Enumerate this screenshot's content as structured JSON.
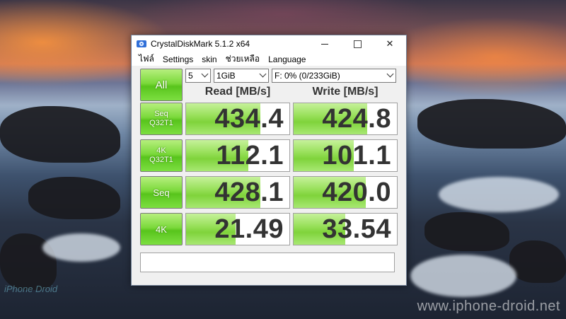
{
  "window": {
    "title": "CrystalDiskMark 5.1.2 x64",
    "close_glyph": "✕"
  },
  "menu": {
    "items": [
      "ไฟล์",
      "Settings",
      "skin",
      "ช่วยเหลือ",
      "Language"
    ]
  },
  "toolbar": {
    "all_label": "All",
    "count_value": "5",
    "size_value": "1GiB",
    "drive_value": "F: 0% (0/233GiB)"
  },
  "headers": {
    "read": "Read [MB/s]",
    "write": "Write [MB/s]"
  },
  "tests": [
    {
      "label_line1": "Seq",
      "label_line2": "Q32T1",
      "read": "434.4",
      "write": "424.8",
      "read_fill": 0.72,
      "write_fill": 0.71
    },
    {
      "label_line1": "4K",
      "label_line2": "Q32T1",
      "read": "112.1",
      "write": "101.1",
      "read_fill": 0.6,
      "write_fill": 0.58
    },
    {
      "label_line1": "Seq",
      "label_line2": "",
      "read": "428.1",
      "write": "420.0",
      "read_fill": 0.72,
      "write_fill": 0.7
    },
    {
      "label_line1": "4K",
      "label_line2": "",
      "read": "21.49",
      "write": "33.54",
      "read_fill": 0.48,
      "write_fill": 0.5
    }
  ],
  "comment": "",
  "desktop": {
    "watermark": "www.iphone-droid.net",
    "logo_text": "iPhone Droid"
  },
  "colors": {
    "accent_green": "#7bd93b"
  }
}
